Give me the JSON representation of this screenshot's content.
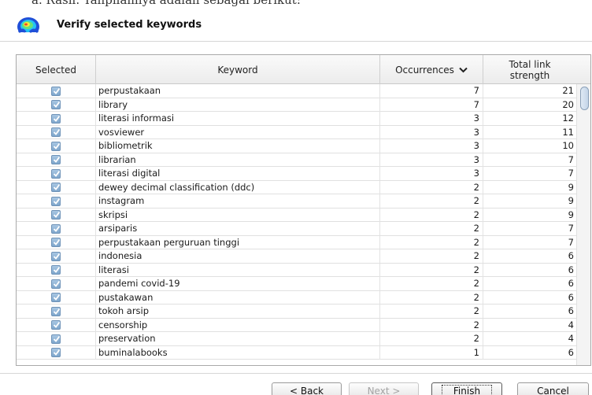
{
  "top_cut_text": "a. Rasil. Tallpilailliya adalali sebagai berikut:",
  "header": {
    "title": "Verify selected keywords"
  },
  "table": {
    "columns": {
      "selected": "Selected",
      "keyword": "Keyword",
      "occurrences": "Occurrences",
      "total_link_strength": "Total link strength"
    },
    "rows": [
      {
        "keyword": "perpustakaan",
        "occurrences": "7",
        "strength": "21"
      },
      {
        "keyword": "library",
        "occurrences": "7",
        "strength": "20"
      },
      {
        "keyword": "literasi informasi",
        "occurrences": "3",
        "strength": "12"
      },
      {
        "keyword": "vosviewer",
        "occurrences": "3",
        "strength": "11"
      },
      {
        "keyword": "bibliometrik",
        "occurrences": "3",
        "strength": "10"
      },
      {
        "keyword": "librarian",
        "occurrences": "3",
        "strength": "7"
      },
      {
        "keyword": "literasi digital",
        "occurrences": "3",
        "strength": "7"
      },
      {
        "keyword": "dewey decimal classification (ddc)",
        "occurrences": "2",
        "strength": "9"
      },
      {
        "keyword": "instagram",
        "occurrences": "2",
        "strength": "9"
      },
      {
        "keyword": "skripsi",
        "occurrences": "2",
        "strength": "9"
      },
      {
        "keyword": "arsiparis",
        "occurrences": "2",
        "strength": "7"
      },
      {
        "keyword": "perpustakaan perguruan tinggi",
        "occurrences": "2",
        "strength": "7"
      },
      {
        "keyword": "indonesia",
        "occurrences": "2",
        "strength": "6"
      },
      {
        "keyword": "literasi",
        "occurrences": "2",
        "strength": "6"
      },
      {
        "keyword": "pandemi covid-19",
        "occurrences": "2",
        "strength": "6"
      },
      {
        "keyword": "pustakawan",
        "occurrences": "2",
        "strength": "6"
      },
      {
        "keyword": "tokoh arsip",
        "occurrences": "2",
        "strength": "6"
      },
      {
        "keyword": "censorship",
        "occurrences": "2",
        "strength": "4"
      },
      {
        "keyword": "preservation",
        "occurrences": "2",
        "strength": "4"
      },
      {
        "keyword": "buminalabooks",
        "occurrences": "1",
        "strength": "6"
      }
    ]
  },
  "buttons": {
    "back": "< Back",
    "next": "Next >",
    "finish": "Finish",
    "cancel": "Cancel"
  },
  "icons": {
    "header": "vosviewer-logo-icon",
    "sort": "chevron-down-icon",
    "checkbox": "checkbox-checked-icon"
  },
  "colors": {
    "checkbox_fill": "#8fb3d6",
    "disabled_text": "#a3a3a3"
  }
}
